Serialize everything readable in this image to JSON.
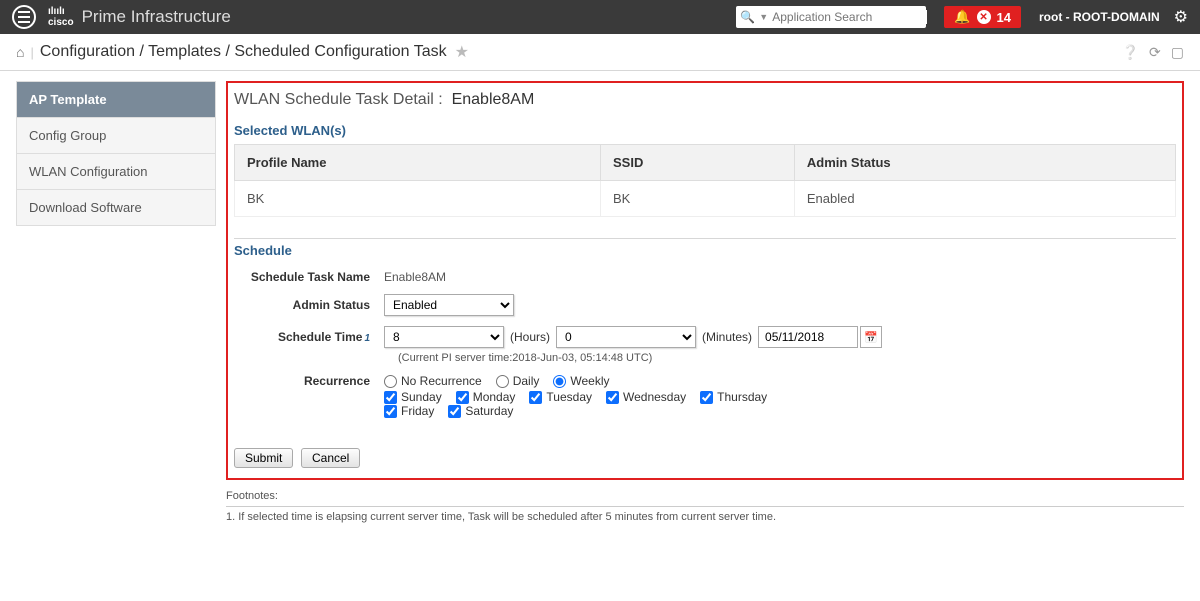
{
  "header": {
    "prime_title": "Prime Infrastructure",
    "search_placeholder": "Application Search",
    "alert_count": "14",
    "user_text": "root - ROOT-DOMAIN",
    "cisco_logo": "cisco"
  },
  "breadcrumb": {
    "text": "Configuration / Templates / Scheduled Configuration Task"
  },
  "sidebar": {
    "items": [
      {
        "label": "AP Template",
        "active": true
      },
      {
        "label": "Config Group",
        "active": false
      },
      {
        "label": "WLAN Configuration",
        "active": false
      },
      {
        "label": "Download Software",
        "active": false
      }
    ]
  },
  "detail": {
    "section_title_prefix": "WLAN Schedule Task Detail :",
    "task_name_heading": "Enable8AM",
    "selected_wlans_heading": "Selected WLAN(s)",
    "schedule_heading": "Schedule",
    "table": {
      "headers": {
        "profile": "Profile Name",
        "ssid": "SSID",
        "admin_status": "Admin Status"
      },
      "rows": [
        {
          "profile": "BK",
          "ssid": "BK",
          "admin_status": "Enabled"
        }
      ]
    },
    "form": {
      "labels": {
        "task_name": "Schedule Task Name",
        "admin_status": "Admin Status",
        "schedule_time": "Schedule Time",
        "recurrence": "Recurrence",
        "hours_unit": "(Hours)",
        "minutes_unit": "(Minutes)"
      },
      "task_name": "Enable8AM",
      "admin_status": "Enabled",
      "hours": "8",
      "minutes": "0",
      "date": "05/11/2018",
      "server_time_note": "(Current PI server time:2018-Jun-03, 05:14:48 UTC)",
      "recurrence_options": {
        "no_recurrence": "No Recurrence",
        "daily": "Daily",
        "weekly": "Weekly"
      },
      "recurrence_selected": "weekly",
      "days": {
        "sunday": "Sunday",
        "monday": "Monday",
        "tuesday": "Tuesday",
        "wednesday": "Wednesday",
        "thursday": "Thursday",
        "friday": "Friday",
        "saturday": "Saturday"
      }
    },
    "buttons": {
      "submit": "Submit",
      "cancel": "Cancel"
    }
  },
  "footnotes": {
    "title": "Footnotes:",
    "note1": "1. If selected time is elapsing current server time, Task will be scheduled after 5 minutes from current server time."
  }
}
